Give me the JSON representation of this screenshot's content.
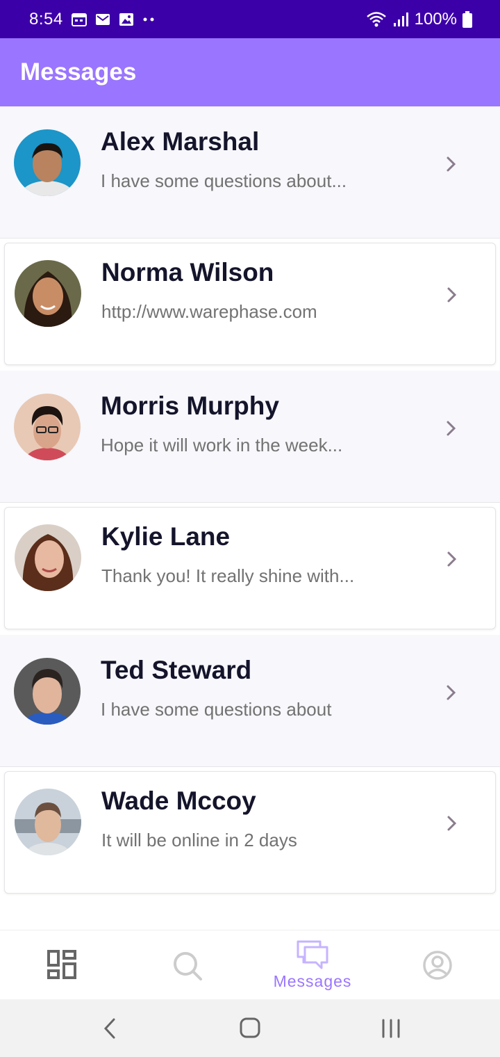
{
  "status_bar": {
    "time": "8:54",
    "battery": "100%",
    "icons": [
      "calendar-icon",
      "mail-icon",
      "image-icon",
      "more-dots-icon",
      "wifi-icon",
      "signal-icon",
      "battery-icon"
    ]
  },
  "header": {
    "title": "Messages"
  },
  "conversations": [
    {
      "name": "Alex Marshal",
      "preview": "I have some questions about...",
      "avatar_bg": "#1c95c8",
      "skin": "#b9835f",
      "hair": "#1a1410"
    },
    {
      "name": "Norma Wilson",
      "preview": "http://www.warephase.com",
      "avatar_bg": "#6a6a4a",
      "skin": "#c98d66",
      "hair": "#2a1a10"
    },
    {
      "name": "Morris Murphy",
      "preview": "Hope it will work in the week...",
      "avatar_bg": "#e8c9b5",
      "skin": "#d9a58a",
      "hair": "#1c1310"
    },
    {
      "name": "Kylie Lane",
      "preview": "Thank you! It really shine with...",
      "avatar_bg": "#d9cfc6",
      "skin": "#e7b9a0",
      "hair": "#5a2e1a"
    },
    {
      "name": "Ted Steward",
      "preview": "I have some questions about",
      "avatar_bg": "#5a5a5a",
      "skin": "#e0b59c",
      "hair": "#2b2320"
    },
    {
      "name": "Wade Mccoy",
      "preview": "It will be online in 2 days",
      "avatar_bg": "#c9d2da",
      "skin": "#e0b89c",
      "hair": "#6b5040"
    }
  ],
  "bottom_nav": {
    "items": [
      {
        "icon": "dashboard-icon",
        "label": ""
      },
      {
        "icon": "search-icon",
        "label": ""
      },
      {
        "icon": "messages-icon",
        "label": "Messages"
      },
      {
        "icon": "profile-icon",
        "label": ""
      }
    ],
    "active_index": 2
  },
  "colors": {
    "status_bar": "#3c00a8",
    "header": "#9a75ff",
    "accent": "#9a75ff",
    "name_text": "#14142b",
    "preview_text": "#727272"
  }
}
